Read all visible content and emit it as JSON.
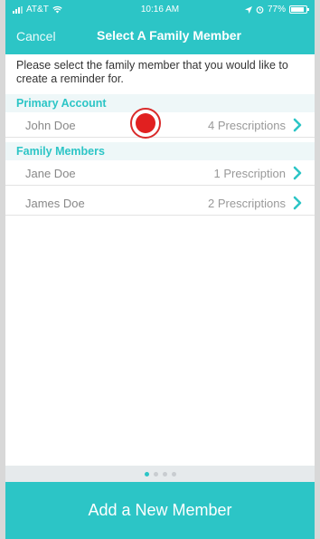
{
  "status_bar": {
    "carrier": "AT&T",
    "time": "10:16 AM",
    "battery": "77%"
  },
  "nav": {
    "cancel_label": "Cancel",
    "title": "Select A Family Member"
  },
  "prompt": "Please select the family member that you would like to create a reminder for.",
  "primary_section": {
    "header": "Primary Account",
    "members": [
      {
        "name": "John Doe",
        "count": "4 Prescriptions"
      }
    ]
  },
  "family_section": {
    "header": "Family Members",
    "members": [
      {
        "name": "Jane Doe",
        "count": "1 Prescription"
      },
      {
        "name": "James Doe",
        "count": "2 Prescriptions"
      }
    ]
  },
  "pager": {
    "pages": 4,
    "active_index": 0
  },
  "add_button_label": "Add a New Member",
  "colors": {
    "accent": "#2cc5c6",
    "section_bg": "#eef7f8",
    "touch_marker": "#e12020"
  }
}
